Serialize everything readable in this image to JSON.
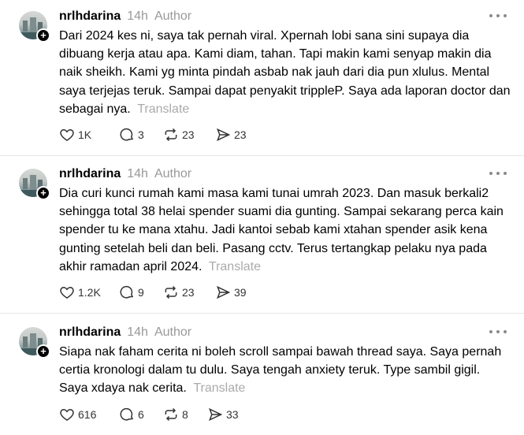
{
  "posts": [
    {
      "username": "nrlhdarina",
      "time": "14h",
      "author_label": "Author",
      "text": "Dari 2024 kes ni, saya tak pernah viral. Xpernah lobi sana sini supaya dia dibuang kerja atau apa. Kami diam, tahan. Tapi makin kami senyap makin dia naik sheikh. Kami yg minta pindah asbab nak jauh dari dia pun xlulus. Mental saya terjejas teruk. Sampai dapat penyakit trippleP. Saya ada laporan doctor dan sebagai nya.",
      "translate_label": "Translate",
      "likes": "1K",
      "replies": "3",
      "reposts": "23",
      "shares": "23"
    },
    {
      "username": "nrlhdarina",
      "time": "14h",
      "author_label": "Author",
      "text": "Dia curi kunci rumah kami masa kami tunai umrah 2023. Dan masuk berkali2 sehingga total 38 helai spender suami dia gunting. Sampai sekarang perca kain spender tu ke mana xtahu. Jadi kantoi sebab kami xtahan spender asik kena gunting setelah beli dan beli. Pasang cctv. Terus tertangkap pelaku nya pada akhir ramadan april 2024.",
      "translate_label": "Translate",
      "likes": "1.2K",
      "replies": "9",
      "reposts": "23",
      "shares": "39"
    },
    {
      "username": "nrlhdarina",
      "time": "14h",
      "author_label": "Author",
      "text": "Siapa nak faham cerita ni boleh scroll sampai bawah thread saya. Saya pernah certia kronologi dalam tu dulu. Saya tengah anxiety teruk. Type sambil gigil. Saya xdaya nak cerita.",
      "translate_label": "Translate",
      "likes": "616",
      "replies": "6",
      "reposts": "8",
      "shares": "33"
    }
  ]
}
